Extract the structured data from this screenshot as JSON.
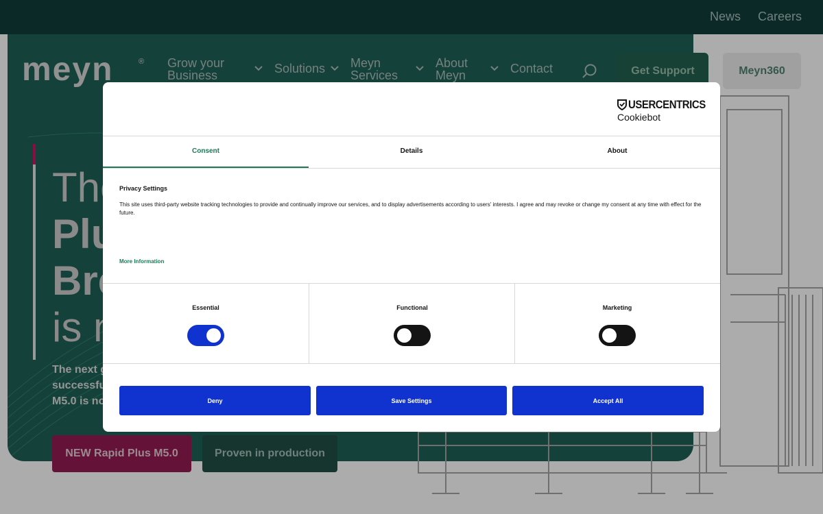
{
  "topbar": {
    "news": "News",
    "careers": "Careers"
  },
  "nav": {
    "logo": "meyn",
    "logo_mark": "®",
    "items": [
      {
        "line1": "Grow your",
        "line2": "Business",
        "has_dropdown": true
      },
      {
        "line1": "Solutions",
        "line2": "",
        "has_dropdown": true
      },
      {
        "line1": "Meyn",
        "line2": "Services",
        "has_dropdown": true
      },
      {
        "line1": "About",
        "line2": "Meyn",
        "has_dropdown": true
      },
      {
        "line1": "Contact",
        "line2": "",
        "has_dropdown": false
      }
    ],
    "search_icon": "search-icon",
    "support_label": "Get Support",
    "meyn360_label": "Meyn360"
  },
  "hero": {
    "title_line1": "The",
    "title_line2": "Plu",
    "title_line3": "Bre",
    "title_line4": "is n",
    "subtitle_line1": "The next g",
    "subtitle_line2": "successfu",
    "subtitle_line3": "M5.0 is no",
    "btn_new": "NEW Rapid Plus M5.0",
    "btn_proven": "Proven in production"
  },
  "consent": {
    "brand": {
      "name": "USERCENTRICS",
      "product": "Cookiebot"
    },
    "tabs": [
      {
        "label": "Consent",
        "active": true
      },
      {
        "label": "Details",
        "active": false
      },
      {
        "label": "About",
        "active": false
      }
    ],
    "privacy_title": "Privacy Settings",
    "privacy_text": "This site uses third-party website tracking technologies to provide and continually improve our services, and to display advertisements according to users' interests. I agree and may revoke or change my consent at any time with effect for the future.",
    "more_info": "More Information",
    "categories": [
      {
        "label": "Essential",
        "enabled": true
      },
      {
        "label": "Functional",
        "enabled": false
      },
      {
        "label": "Marketing",
        "enabled": false
      }
    ],
    "buttons": {
      "deny": "Deny",
      "save": "Save Settings",
      "accept": "Accept All"
    }
  },
  "colors": {
    "topbar": "#0f3a37",
    "hero": "#1c5a4f",
    "accent_pink": "#c0145e",
    "consent_blue": "#1032cf",
    "consent_green": "#1d7a55"
  }
}
